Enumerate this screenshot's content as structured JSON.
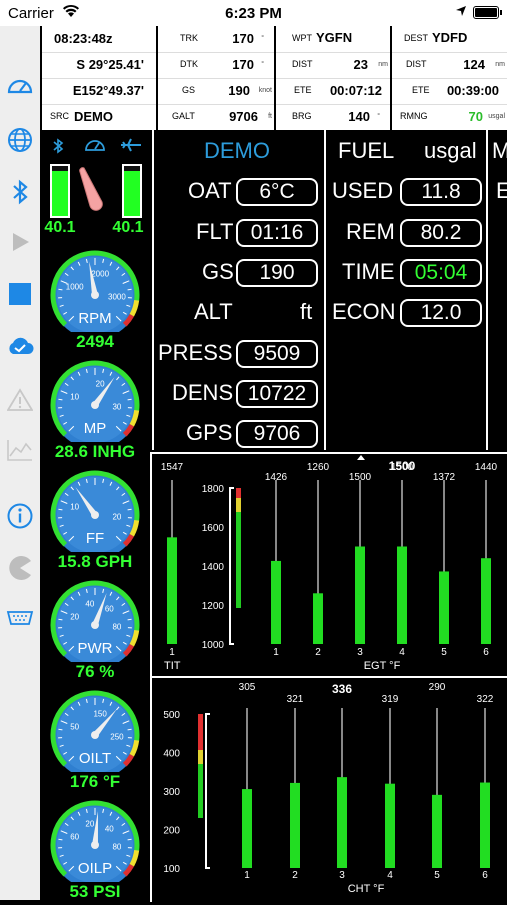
{
  "status": {
    "carrier": "Carrier",
    "time": "6:23 PM"
  },
  "nav": {
    "time": "08:23:48z",
    "lat": "S 29°25.41'",
    "lon": "E152°49.37'",
    "src_label": "SRC",
    "src_value": "DEMO",
    "trk_label": "TRK",
    "trk_value": "170",
    "trk_unit": "°",
    "dtk_label": "DTK",
    "dtk_value": "170",
    "dtk_unit": "°",
    "gs_label": "GS",
    "gs_value": "190",
    "gs_unit": "knot",
    "galt_label": "GALT",
    "galt_value": "9706",
    "galt_unit": "ft",
    "wpt_label": "WPT",
    "wpt_value": "YGFN",
    "dist_label": "DIST",
    "dist_value": "23",
    "dist_unit": "nm",
    "ete_label": "ETE",
    "ete_value": "00:07:12",
    "brg_label": "BRG",
    "brg_value": "140",
    "brg_unit": "°",
    "dest_label": "DEST",
    "dest_value": "YDFD",
    "dest_dist_label": "DIST",
    "dest_dist_value": "124",
    "dest_dist_unit": "nm",
    "dest_ete_label": "ETE",
    "dest_ete_value": "00:39:00",
    "rmng_label": "RMNG",
    "rmng_value": "70",
    "rmng_unit": "usgal"
  },
  "fuelbars": {
    "left_value": "40.1",
    "right_value": "40.1",
    "left_level": 0.9,
    "right_level": 0.9
  },
  "gauges": [
    {
      "name": "RPM",
      "value": "2494",
      "ticks": [
        "1000",
        "2000",
        "3000"
      ]
    },
    {
      "name": "MP",
      "value": "28.6 INHG",
      "ticks": [
        "10",
        "20",
        "30"
      ]
    },
    {
      "name": "FF",
      "value": "15.8 GPH",
      "ticks": [
        "10",
        "20"
      ]
    },
    {
      "name": "PWR",
      "value": "76 %",
      "ticks": [
        "20",
        "40",
        "60",
        "80"
      ]
    },
    {
      "name": "OILT",
      "value": "176 °F",
      "ticks": [
        "50",
        "150",
        "250"
      ]
    },
    {
      "name": "OILP",
      "value": "53 PSI",
      "ticks": [
        "60",
        "20",
        "40",
        "80"
      ]
    }
  ],
  "data_panel": {
    "mode": "DEMO",
    "oat_label": "OAT",
    "oat_value": "6°C",
    "flt_label": "FLT",
    "flt_value": "01:16",
    "gs_label": "GS",
    "gs_value": "190",
    "alt_label": "ALT",
    "alt_unit": "ft",
    "press_label": "PRESS",
    "press_value": "9509",
    "dens_label": "DENS",
    "dens_value": "10722",
    "gps_label": "GPS",
    "gps_value": "9706",
    "fuel_label": "FUEL",
    "fuel_unit": "usgal",
    "used_label": "USED",
    "used_value": "11.8",
    "rem_label": "REM",
    "rem_value": "80.2",
    "time_label": "TIME",
    "time_value": "05:04",
    "econ_label": "ECON",
    "econ_value": "12.0",
    "edge_m": "M",
    "edge_e": "E"
  },
  "chart_data": [
    {
      "type": "bar",
      "title": "",
      "xlabel": "EGT °F",
      "tit_label": "TIT",
      "ylim": [
        1000,
        1800
      ],
      "yticks": [
        "1800",
        "1600",
        "1400",
        "1200",
        "1000"
      ],
      "tit": {
        "category": "1",
        "value": 1547,
        "max": 1800
      },
      "categories": [
        "1",
        "2",
        "3",
        "4",
        "5",
        "6"
      ],
      "values": [
        1426,
        1260,
        1500,
        1500,
        1372,
        1440
      ],
      "peak_label": "1500"
    },
    {
      "type": "bar",
      "title": "",
      "xlabel": "CHT °F",
      "ylim": [
        100,
        500
      ],
      "yticks": [
        "500",
        "400",
        "300",
        "200",
        "100"
      ],
      "categories": [
        "1",
        "2",
        "3",
        "4",
        "5",
        "6"
      ],
      "values": [
        305,
        321,
        336,
        319,
        290,
        322
      ],
      "peak_label": "336"
    }
  ],
  "colors": {
    "green": "#33ff33",
    "accent": "#2d9cdb",
    "gauge_blue": "#2f7fd0",
    "sidebar_blue": "#1e88e5"
  }
}
